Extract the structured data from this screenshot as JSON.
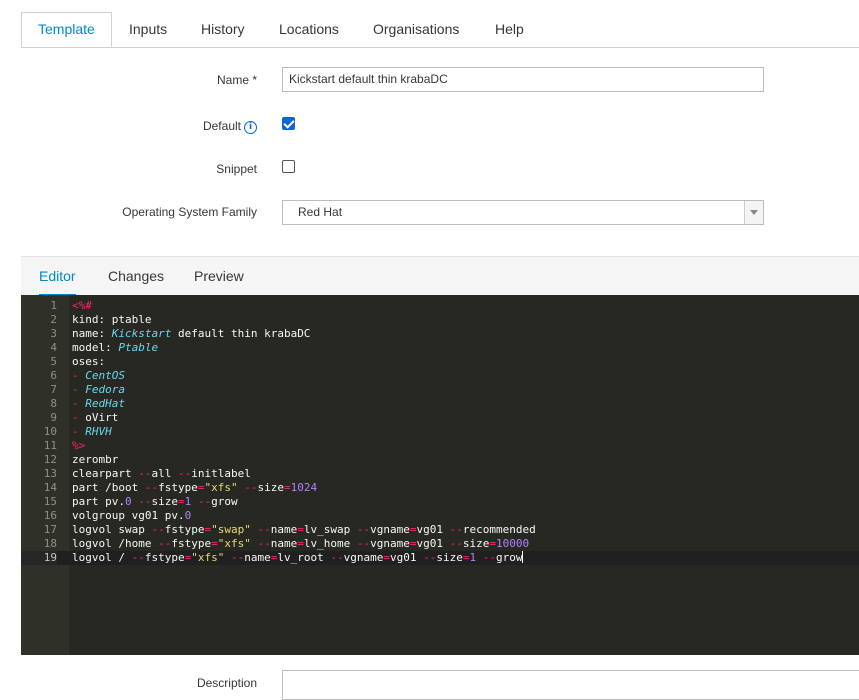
{
  "tabs": [
    {
      "label": "Template",
      "active": true
    },
    {
      "label": "Inputs"
    },
    {
      "label": "History"
    },
    {
      "label": "Locations"
    },
    {
      "label": "Organisations"
    },
    {
      "label": "Help"
    }
  ],
  "form": {
    "name_label": "Name *",
    "name_value": "Kickstart default thin krabaDC",
    "default_label": "Default",
    "default_info_icon": "info-icon",
    "default_checked": true,
    "snippet_label": "Snippet",
    "snippet_checked": false,
    "os_family_label": "Operating System Family",
    "os_family_value": "Red Hat",
    "description_label": "Description"
  },
  "editor": {
    "tabs": [
      {
        "label": "Editor",
        "active": true
      },
      {
        "label": "Changes"
      },
      {
        "label": "Preview"
      }
    ],
    "current_line": 19,
    "lines": [
      "<%#",
      "kind: ptable",
      "name: Kickstart default thin krabaDC",
      "model: Ptable",
      "oses:",
      "- CentOS",
      "- Fedora",
      "- RedHat",
      "- oVirt",
      "- RHVH",
      "%>",
      "zerombr",
      "clearpart --all --initlabel",
      "part /boot --fstype=\"xfs\" --size=1024",
      "part pv.0 --size=1 --grow",
      "volgroup vg01 pv.0",
      "logvol swap --fstype=\"swap\" --name=lv_swap --vgname=vg01 --recommended",
      "logvol /home --fstype=\"xfs\" --name=lv_home --vgname=vg01 --size=10000",
      "logvol / --fstype=\"xfs\" --name=lv_root --vgname=vg01 --size=1 --grow"
    ]
  },
  "colors": {
    "accent": "#0088ce",
    "editor_bg": "#272822",
    "keyword": "#f92672",
    "italic_type": "#66d9ef",
    "number": "#ae81ff",
    "string": "#e6db74"
  }
}
